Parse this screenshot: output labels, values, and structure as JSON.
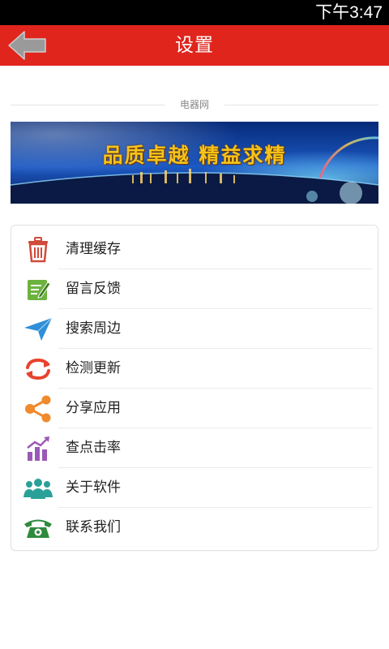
{
  "status_bar": {
    "time": "下午3:47"
  },
  "header": {
    "title": "设置",
    "back_icon": "back-arrow-icon",
    "background": "#e0251d"
  },
  "section": {
    "label": "电器网"
  },
  "banner": {
    "text": "品质卓越  精益求精"
  },
  "menu": {
    "items": [
      {
        "label": "清理缓存",
        "icon": "trash-icon",
        "color": "#d14a3a"
      },
      {
        "label": "留言反馈",
        "icon": "edit-icon",
        "color": "#6cb33e"
      },
      {
        "label": "搜索周边",
        "icon": "location-arrow-icon",
        "color": "#2f8fd8"
      },
      {
        "label": "检测更新",
        "icon": "refresh-icon",
        "color": "#e8432e"
      },
      {
        "label": "分享应用",
        "icon": "share-icon",
        "color": "#f08a2d"
      },
      {
        "label": "查点击率",
        "icon": "bar-chart-icon",
        "color": "#9b59b6"
      },
      {
        "label": "关于软件",
        "icon": "users-icon",
        "color": "#2aa198"
      },
      {
        "label": "联系我们",
        "icon": "telephone-icon",
        "color": "#2e8b3d"
      }
    ]
  }
}
